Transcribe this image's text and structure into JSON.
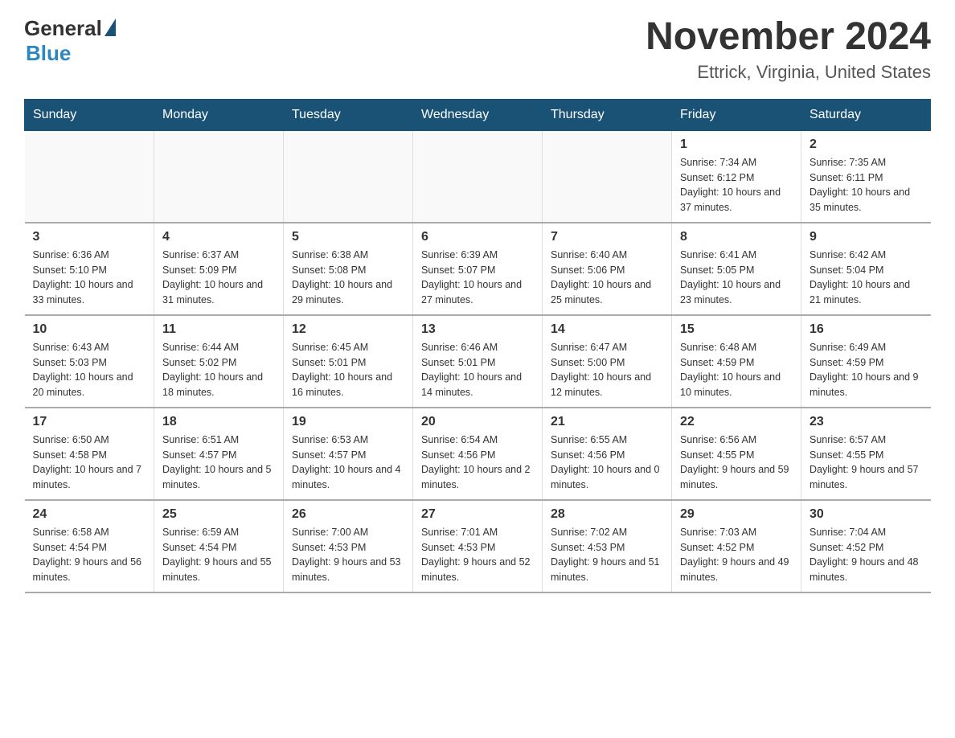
{
  "header": {
    "logo_general": "General",
    "logo_blue": "Blue",
    "title": "November 2024",
    "subtitle": "Ettrick, Virginia, United States"
  },
  "days_of_week": [
    "Sunday",
    "Monday",
    "Tuesday",
    "Wednesday",
    "Thursday",
    "Friday",
    "Saturday"
  ],
  "weeks": [
    [
      {
        "day": "",
        "sunrise": "",
        "sunset": "",
        "daylight": ""
      },
      {
        "day": "",
        "sunrise": "",
        "sunset": "",
        "daylight": ""
      },
      {
        "day": "",
        "sunrise": "",
        "sunset": "",
        "daylight": ""
      },
      {
        "day": "",
        "sunrise": "",
        "sunset": "",
        "daylight": ""
      },
      {
        "day": "",
        "sunrise": "",
        "sunset": "",
        "daylight": ""
      },
      {
        "day": "1",
        "sunrise": "Sunrise: 7:34 AM",
        "sunset": "Sunset: 6:12 PM",
        "daylight": "Daylight: 10 hours and 37 minutes."
      },
      {
        "day": "2",
        "sunrise": "Sunrise: 7:35 AM",
        "sunset": "Sunset: 6:11 PM",
        "daylight": "Daylight: 10 hours and 35 minutes."
      }
    ],
    [
      {
        "day": "3",
        "sunrise": "Sunrise: 6:36 AM",
        "sunset": "Sunset: 5:10 PM",
        "daylight": "Daylight: 10 hours and 33 minutes."
      },
      {
        "day": "4",
        "sunrise": "Sunrise: 6:37 AM",
        "sunset": "Sunset: 5:09 PM",
        "daylight": "Daylight: 10 hours and 31 minutes."
      },
      {
        "day": "5",
        "sunrise": "Sunrise: 6:38 AM",
        "sunset": "Sunset: 5:08 PM",
        "daylight": "Daylight: 10 hours and 29 minutes."
      },
      {
        "day": "6",
        "sunrise": "Sunrise: 6:39 AM",
        "sunset": "Sunset: 5:07 PM",
        "daylight": "Daylight: 10 hours and 27 minutes."
      },
      {
        "day": "7",
        "sunrise": "Sunrise: 6:40 AM",
        "sunset": "Sunset: 5:06 PM",
        "daylight": "Daylight: 10 hours and 25 minutes."
      },
      {
        "day": "8",
        "sunrise": "Sunrise: 6:41 AM",
        "sunset": "Sunset: 5:05 PM",
        "daylight": "Daylight: 10 hours and 23 minutes."
      },
      {
        "day": "9",
        "sunrise": "Sunrise: 6:42 AM",
        "sunset": "Sunset: 5:04 PM",
        "daylight": "Daylight: 10 hours and 21 minutes."
      }
    ],
    [
      {
        "day": "10",
        "sunrise": "Sunrise: 6:43 AM",
        "sunset": "Sunset: 5:03 PM",
        "daylight": "Daylight: 10 hours and 20 minutes."
      },
      {
        "day": "11",
        "sunrise": "Sunrise: 6:44 AM",
        "sunset": "Sunset: 5:02 PM",
        "daylight": "Daylight: 10 hours and 18 minutes."
      },
      {
        "day": "12",
        "sunrise": "Sunrise: 6:45 AM",
        "sunset": "Sunset: 5:01 PM",
        "daylight": "Daylight: 10 hours and 16 minutes."
      },
      {
        "day": "13",
        "sunrise": "Sunrise: 6:46 AM",
        "sunset": "Sunset: 5:01 PM",
        "daylight": "Daylight: 10 hours and 14 minutes."
      },
      {
        "day": "14",
        "sunrise": "Sunrise: 6:47 AM",
        "sunset": "Sunset: 5:00 PM",
        "daylight": "Daylight: 10 hours and 12 minutes."
      },
      {
        "day": "15",
        "sunrise": "Sunrise: 6:48 AM",
        "sunset": "Sunset: 4:59 PM",
        "daylight": "Daylight: 10 hours and 10 minutes."
      },
      {
        "day": "16",
        "sunrise": "Sunrise: 6:49 AM",
        "sunset": "Sunset: 4:59 PM",
        "daylight": "Daylight: 10 hours and 9 minutes."
      }
    ],
    [
      {
        "day": "17",
        "sunrise": "Sunrise: 6:50 AM",
        "sunset": "Sunset: 4:58 PM",
        "daylight": "Daylight: 10 hours and 7 minutes."
      },
      {
        "day": "18",
        "sunrise": "Sunrise: 6:51 AM",
        "sunset": "Sunset: 4:57 PM",
        "daylight": "Daylight: 10 hours and 5 minutes."
      },
      {
        "day": "19",
        "sunrise": "Sunrise: 6:53 AM",
        "sunset": "Sunset: 4:57 PM",
        "daylight": "Daylight: 10 hours and 4 minutes."
      },
      {
        "day": "20",
        "sunrise": "Sunrise: 6:54 AM",
        "sunset": "Sunset: 4:56 PM",
        "daylight": "Daylight: 10 hours and 2 minutes."
      },
      {
        "day": "21",
        "sunrise": "Sunrise: 6:55 AM",
        "sunset": "Sunset: 4:56 PM",
        "daylight": "Daylight: 10 hours and 0 minutes."
      },
      {
        "day": "22",
        "sunrise": "Sunrise: 6:56 AM",
        "sunset": "Sunset: 4:55 PM",
        "daylight": "Daylight: 9 hours and 59 minutes."
      },
      {
        "day": "23",
        "sunrise": "Sunrise: 6:57 AM",
        "sunset": "Sunset: 4:55 PM",
        "daylight": "Daylight: 9 hours and 57 minutes."
      }
    ],
    [
      {
        "day": "24",
        "sunrise": "Sunrise: 6:58 AM",
        "sunset": "Sunset: 4:54 PM",
        "daylight": "Daylight: 9 hours and 56 minutes."
      },
      {
        "day": "25",
        "sunrise": "Sunrise: 6:59 AM",
        "sunset": "Sunset: 4:54 PM",
        "daylight": "Daylight: 9 hours and 55 minutes."
      },
      {
        "day": "26",
        "sunrise": "Sunrise: 7:00 AM",
        "sunset": "Sunset: 4:53 PM",
        "daylight": "Daylight: 9 hours and 53 minutes."
      },
      {
        "day": "27",
        "sunrise": "Sunrise: 7:01 AM",
        "sunset": "Sunset: 4:53 PM",
        "daylight": "Daylight: 9 hours and 52 minutes."
      },
      {
        "day": "28",
        "sunrise": "Sunrise: 7:02 AM",
        "sunset": "Sunset: 4:53 PM",
        "daylight": "Daylight: 9 hours and 51 minutes."
      },
      {
        "day": "29",
        "sunrise": "Sunrise: 7:03 AM",
        "sunset": "Sunset: 4:52 PM",
        "daylight": "Daylight: 9 hours and 49 minutes."
      },
      {
        "day": "30",
        "sunrise": "Sunrise: 7:04 AM",
        "sunset": "Sunset: 4:52 PM",
        "daylight": "Daylight: 9 hours and 48 minutes."
      }
    ]
  ]
}
